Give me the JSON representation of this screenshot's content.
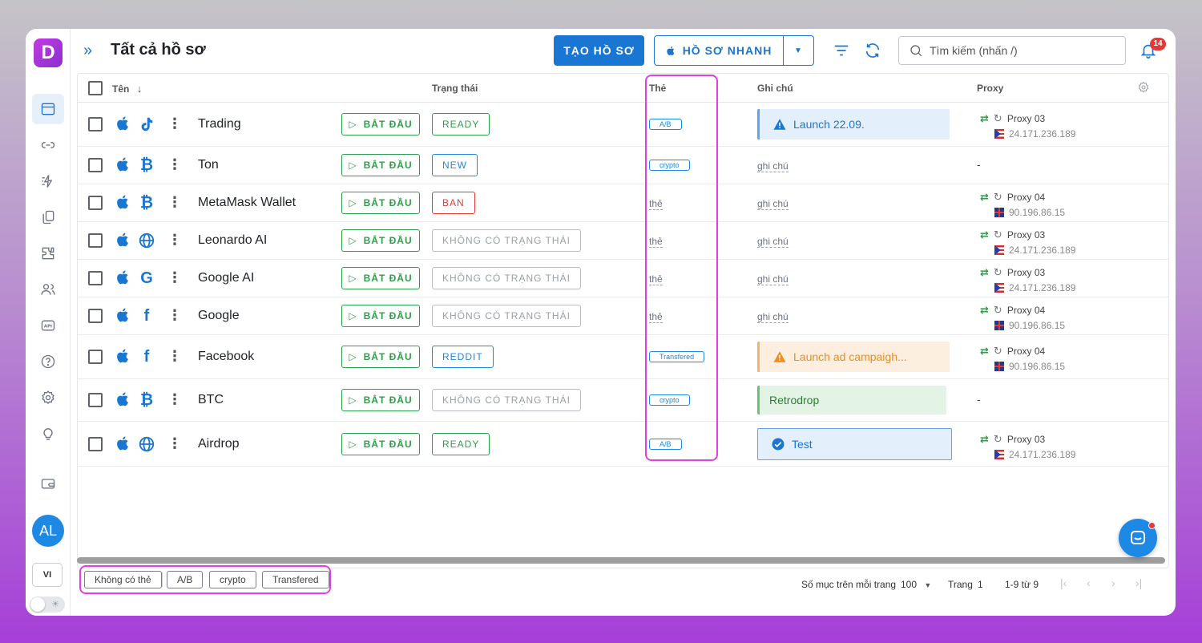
{
  "header": {
    "title": "Tất cả hồ sơ",
    "create_label": "TẠO HỒ SƠ",
    "quick_label": "HỒ SƠ NHANH",
    "search_placeholder": "Tìm kiếm (nhấn /)",
    "notification_count": "14"
  },
  "sidebar": {
    "logo": "D",
    "avatar": "AL",
    "language": "VI",
    "icons": [
      "profiles-icon",
      "link-icon",
      "automation-icon",
      "copy-icon",
      "extension-icon",
      "team-icon",
      "api-icon",
      "help-icon",
      "settings-icon",
      "idea-icon",
      "wallet-icon"
    ]
  },
  "table": {
    "columns": {
      "name": "Tên",
      "status": "Trạng thái",
      "tags": "Thẻ",
      "notes": "Ghi chú",
      "proxy": "Proxy"
    },
    "start_label": "BẮT ĐẦU",
    "tag_placeholder": "thẻ",
    "note_placeholder": "ghi chú",
    "rows": [
      {
        "name": "Trading",
        "site": "tiktok-icon",
        "status": "READY",
        "tag": "A/B",
        "note": "Launch 22.09.",
        "proxy_name": "Proxy 03",
        "proxy_ip": "24.171.236.189"
      },
      {
        "name": "Ton",
        "site": "bitcoin-icon",
        "status": "NEW",
        "tag": "crypto",
        "note": "ghi chú",
        "proxy_dash": "-"
      },
      {
        "name": "MetaMask Wallet",
        "site": "bitcoin-icon",
        "status": "BAN",
        "tag": "thẻ",
        "note": "ghi chú",
        "proxy_name": "Proxy 04",
        "proxy_ip": "90.196.86.15"
      },
      {
        "name": "Leonardo AI",
        "site": "globe-icon",
        "status": "KHÔNG CÓ TRẠNG THÁI",
        "tag": "thẻ",
        "note": "ghi chú",
        "proxy_name": "Proxy 03",
        "proxy_ip": "24.171.236.189"
      },
      {
        "name": "Google AI",
        "site": "google-icon",
        "status": "KHÔNG CÓ TRẠNG THÁI",
        "tag": "thẻ",
        "note": "ghi chú",
        "proxy_name": "Proxy 03",
        "proxy_ip": "24.171.236.189"
      },
      {
        "name": "Google",
        "site": "facebook-icon",
        "status": "KHÔNG CÓ TRẠNG THÁI",
        "tag": "thẻ",
        "note": "ghi chú",
        "proxy_name": "Proxy 04",
        "proxy_ip": "90.196.86.15"
      },
      {
        "name": "Facebook",
        "site": "facebook-icon",
        "status": "REDDIT",
        "tag": "Transfered",
        "note": "Launch ad campaigh...",
        "proxy_name": "Proxy 04",
        "proxy_ip": "90.196.86.15"
      },
      {
        "name": "BTC",
        "site": "bitcoin-icon",
        "status": "KHÔNG CÓ TRẠNG THÁI",
        "tag": "crypto",
        "note": "Retrodrop",
        "proxy_dash": "-"
      },
      {
        "name": "Airdrop",
        "site": "globe-icon",
        "status": "READY",
        "tag": "A/B",
        "note": "Test",
        "proxy_name": "Proxy 03",
        "proxy_ip": "24.171.236.189"
      }
    ]
  },
  "footer": {
    "tag_filters": [
      "Không có thẻ",
      "A/B",
      "crypto",
      "Transfered"
    ],
    "per_page_label": "Số mục trên mỗi trang",
    "per_page_value": "100",
    "page_label": "Trang",
    "page_value": "1",
    "range": "1-9 từ 9"
  },
  "colors": {
    "primary": "#1976d2",
    "success": "#2e9e4a",
    "danger": "#e53935",
    "highlight": "#e040e0"
  }
}
